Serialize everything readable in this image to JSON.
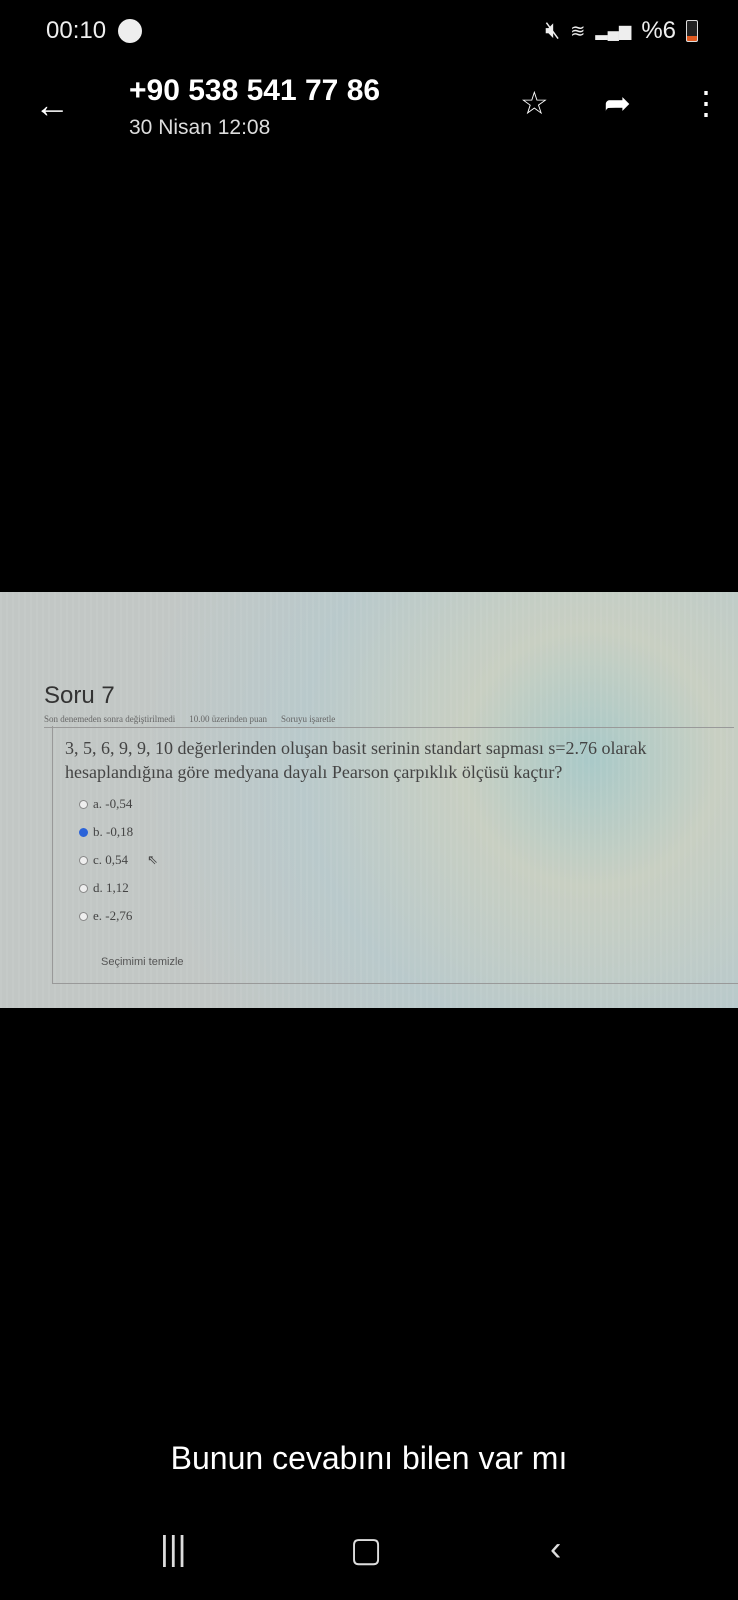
{
  "status": {
    "time": "00:10",
    "battery": "%6",
    "icons": [
      "spotify-icon",
      "mute-icon",
      "wifi-icon",
      "signal-icon",
      "battery-icon"
    ]
  },
  "header": {
    "title": "+90 538 541 77 86",
    "subtitle": "30 Nisan 12:08"
  },
  "quiz": {
    "title": "Soru 7",
    "meta": [
      "Son denemeden sonra değiştirilmedi",
      "10.00 üzerinden puan",
      "Soruyu işaretle"
    ],
    "question": "3, 5, 6, 9, 9, 10 değerlerinden oluşan basit serinin standart sapması s=2.76 olarak hesaplandığına göre medyana dayalı Pearson çarpıklık ölçüsü kaçtır?",
    "options": [
      {
        "label": "a. -0,54",
        "selected": false
      },
      {
        "label": "b. -0,18",
        "selected": true
      },
      {
        "label": "c. 0,54",
        "selected": false
      },
      {
        "label": "d. 1,12",
        "selected": false
      },
      {
        "label": "e. -2,76",
        "selected": false
      }
    ],
    "clear": "Seçimimi temizle"
  },
  "caption": "Bunun cevabını bilen var mı"
}
